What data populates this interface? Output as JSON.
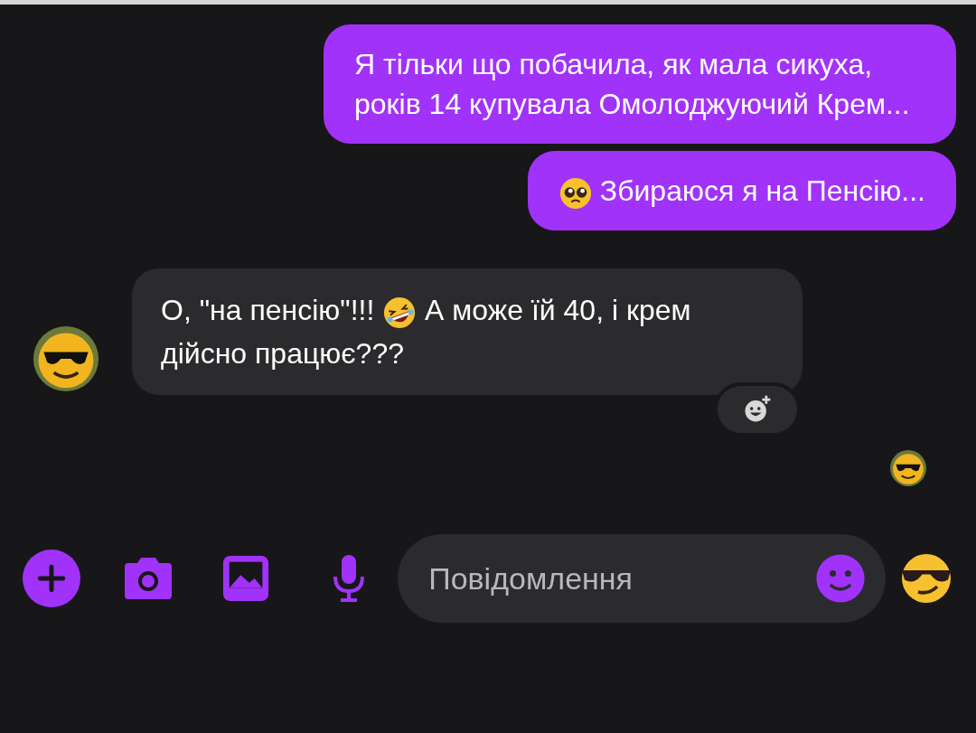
{
  "messages": [
    {
      "kind": "outgoing",
      "segments": [
        {
          "kind": "text",
          "text": "Я тільки що побачила, як мала сикуха, років 14 купувала Омолоджуючий Крем..."
        }
      ]
    },
    {
      "kind": "outgoing",
      "segments": [
        {
          "kind": "emoji"
        },
        {
          "kind": "text",
          "text": "Збираюся я на Пенсію..."
        }
      ]
    },
    {
      "kind": "incoming",
      "segments": [
        {
          "kind": "text",
          "text": "О, \"на пенсію\"!!! "
        },
        {
          "kind": "emoji"
        },
        {
          "kind": "text",
          "text": " А може їй 40, і крем дійсно працює???"
        }
      ]
    }
  ],
  "composer": {
    "placeholder": "Повідомлення"
  }
}
